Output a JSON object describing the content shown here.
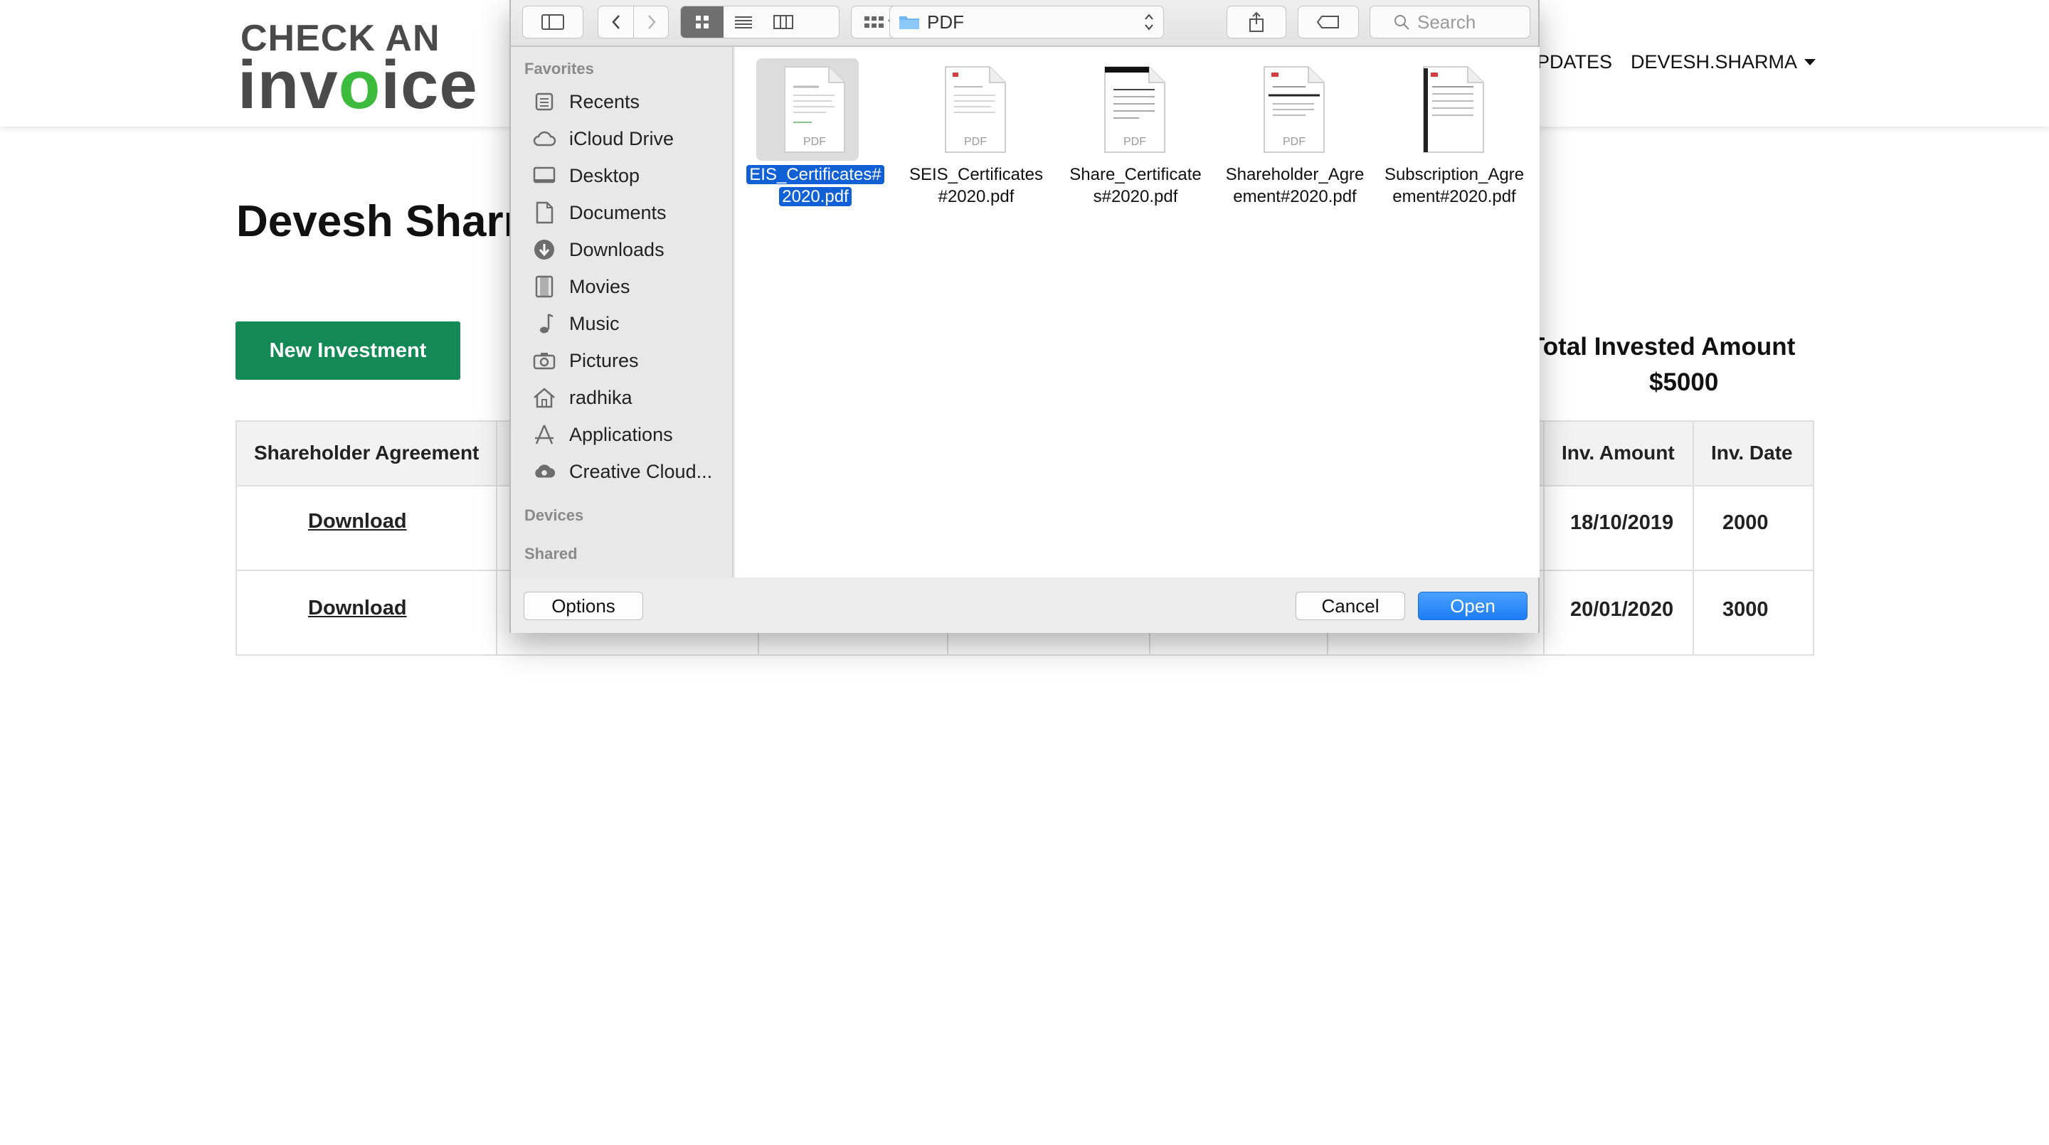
{
  "site": {
    "logo_line1": "CHECK AN",
    "logo_part1": "inv",
    "logo_part2": "o",
    "logo_part3": "ice",
    "nav_updates": "PDATES",
    "nav_user": "DEVESH.SHARMA"
  },
  "main": {
    "heading": "Devesh Sharn",
    "new_investment": "New Investment",
    "total_label": "Total Invested Amount",
    "total_value": "$5000",
    "table": {
      "headers": [
        "Shareholder Agreement",
        "Inv. Amount",
        "Inv. Date"
      ],
      "rows": [
        {
          "agreement": "Download",
          "inv_amount": "18/10/2019",
          "inv_date": "2000"
        },
        {
          "agreement": "Download",
          "inv_amount": "20/01/2020",
          "inv_date": "3000"
        }
      ]
    }
  },
  "dialog": {
    "location": "PDF",
    "search_placeholder": "Search",
    "favorites_label": "Favorites",
    "favorites": [
      {
        "label": "Recents",
        "icon": "recents-icon"
      },
      {
        "label": "iCloud Drive",
        "icon": "cloud-icon"
      },
      {
        "label": "Desktop",
        "icon": "desktop-icon"
      },
      {
        "label": "Documents",
        "icon": "documents-icon"
      },
      {
        "label": "Downloads",
        "icon": "downloads-icon"
      },
      {
        "label": "Movies",
        "icon": "movies-icon"
      },
      {
        "label": "Music",
        "icon": "music-icon"
      },
      {
        "label": "Pictures",
        "icon": "camera-icon"
      },
      {
        "label": "radhika",
        "icon": "home-icon"
      },
      {
        "label": "Applications",
        "icon": "applications-icon"
      },
      {
        "label": "Creative Cloud...",
        "icon": "creative-cloud-icon"
      }
    ],
    "devices_label": "Devices",
    "shared_label": "Shared",
    "files": [
      {
        "line1": "EIS_Certificates#",
        "line2": "2020.pdf",
        "selected": true
      },
      {
        "line1": "SEIS_Certificates",
        "line2": "#2020.pdf",
        "selected": false
      },
      {
        "line1": "Share_Certificate",
        "line2": "s#2020.pdf",
        "selected": false
      },
      {
        "line1": "Shareholder_Agre",
        "line2": "ement#2020.pdf",
        "selected": false
      },
      {
        "line1": "Subscription_Agre",
        "line2": "ement#2020.pdf",
        "selected": false
      }
    ],
    "pdf_badge": "PDF",
    "options": "Options",
    "cancel": "Cancel",
    "open": "Open",
    "colors": {
      "accent": "#1160d6",
      "open_button": "#1b7cf5",
      "brand_green": "#138a55",
      "logo_green": "#3dbb3d"
    }
  }
}
